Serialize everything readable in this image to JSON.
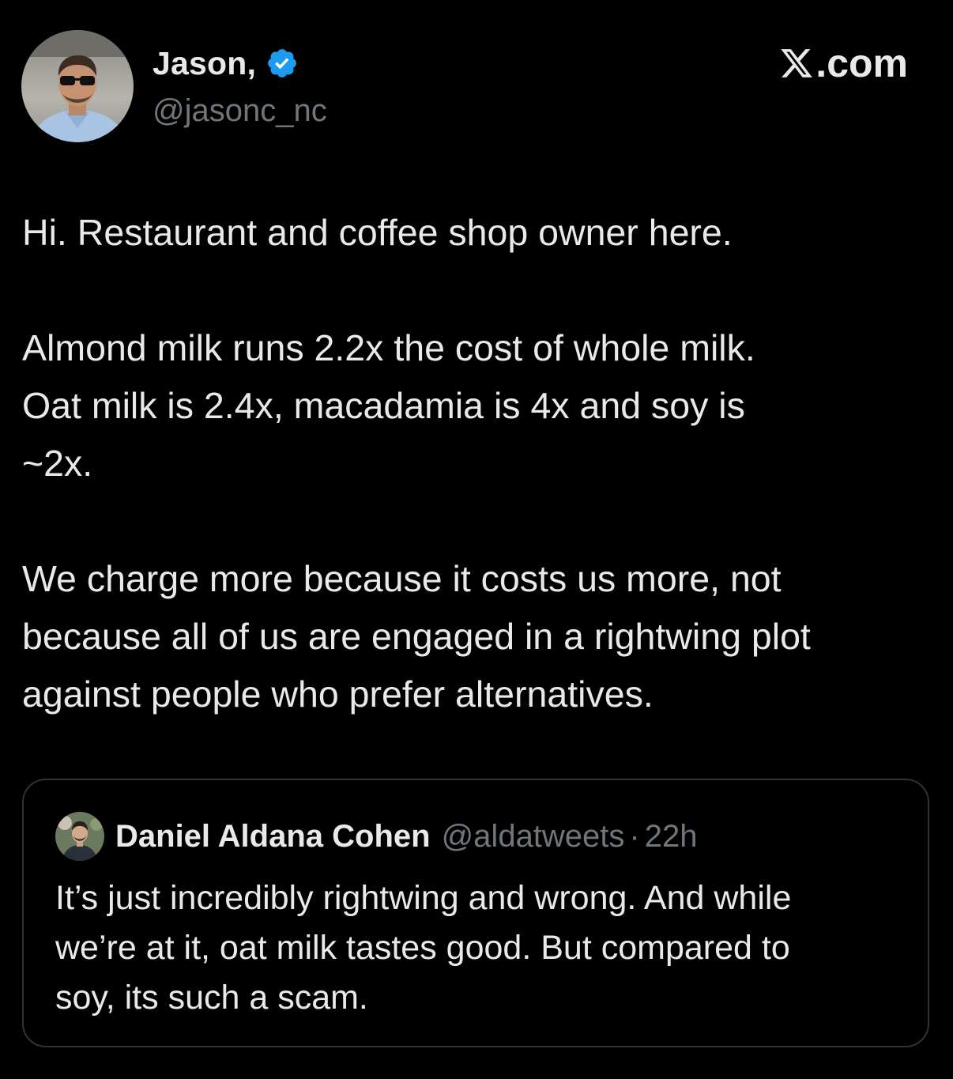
{
  "author": {
    "name": "Jason,",
    "handle": "@jasonc_nc",
    "verified": true,
    "avatar_icon": "person-photo-avatar",
    "badge_color": "#1d9bf0"
  },
  "brand": {
    "label": ".com",
    "logo_icon": "x-logo-icon"
  },
  "tweet": {
    "paragraphs": [
      "Hi. Restaurant and coffee shop owner here.",
      "Almond milk runs 2.2x the cost of whole milk.\nOat milk is 2.4x, macadamia is 4x and soy is\n~2x.",
      "We charge more because it costs us more, not\nbecause all of us are engaged in a rightwing plot\nagainst people who prefer alternatives."
    ]
  },
  "quote": {
    "name": "Daniel Aldana Cohen",
    "handle": "@aldatweets",
    "separator": "·",
    "time": "22h",
    "avatar_icon": "person-photo-avatar",
    "text": "It’s just incredibly rightwing and wrong. And while\nwe’re at it, oat milk tastes good. But compared to\nsoy, its such a scam."
  },
  "colors": {
    "background": "#000000",
    "text_primary": "#e7e9ea",
    "text_secondary": "#71767b",
    "border": "#2f3336",
    "accent": "#1d9bf0"
  }
}
